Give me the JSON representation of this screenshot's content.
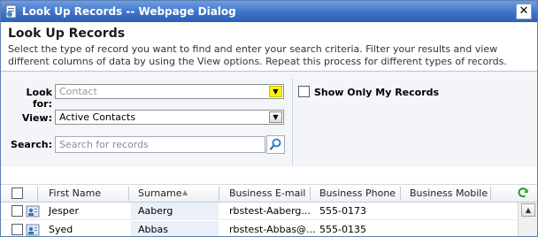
{
  "window": {
    "title": "Look Up Records -- Webpage Dialog",
    "close_glyph": "✕"
  },
  "header": {
    "title": "Look Up Records",
    "description": "Select the type of record you want to find and enter your search criteria. Filter your results and view different columns of data by using the View options. Repeat this process for different types of records."
  },
  "form": {
    "look_for_label": "Look for:",
    "look_for_value": "Contact",
    "view_label": "View:",
    "view_value": "Active Contacts",
    "search_label": "Search:",
    "search_placeholder": "Search for records",
    "show_only_mine_label": "Show Only My Records",
    "show_only_mine_checked": false,
    "dropdown_glyph": "▼",
    "highlight_color": "#f7f40a"
  },
  "grid": {
    "columns": [
      "First Name",
      "Surname",
      "Business E-mail",
      "Business Phone",
      "Business Mobile"
    ],
    "sort_glyph": "▲",
    "refresh_icon": "refresh-icon",
    "rows": [
      {
        "first_name": "Jesper",
        "surname": "Aaberg",
        "email": "rbstest-Aaberg...",
        "phone": "555-0173",
        "mobile": ""
      },
      {
        "first_name": "Syed",
        "surname": "Abbas",
        "email": "rbstest-Abbas@...",
        "phone": "555-0135",
        "mobile": ""
      }
    ]
  },
  "scrollbar": {
    "up_glyph": "▲"
  }
}
